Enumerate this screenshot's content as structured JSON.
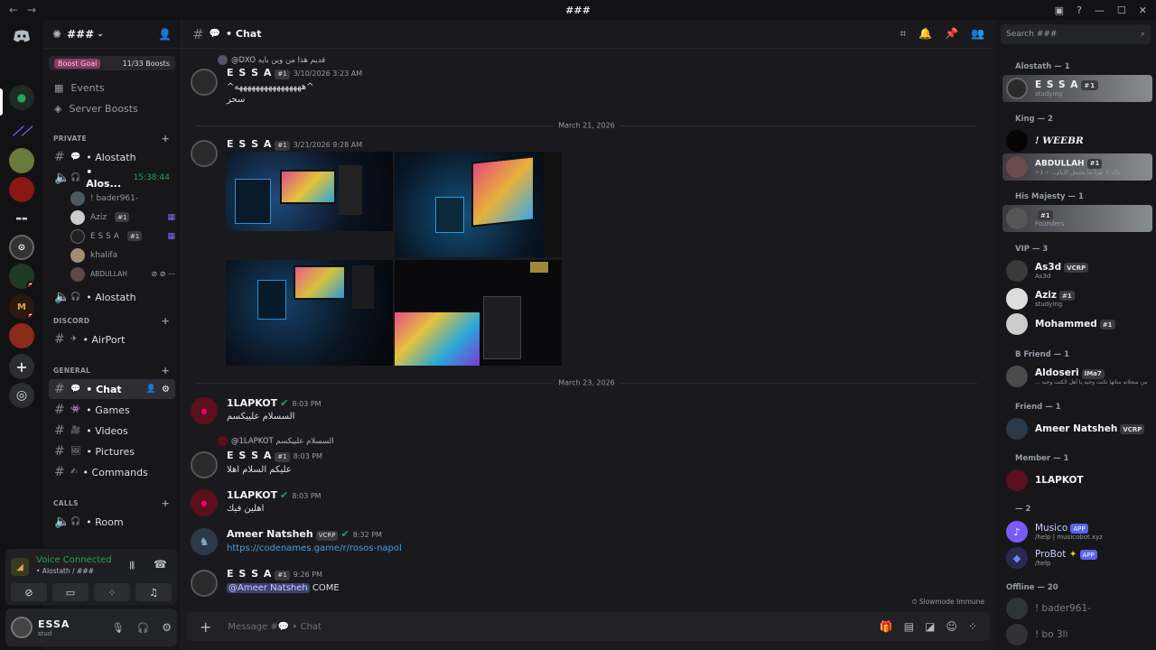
{
  "window": {
    "title": "###",
    "back": "←",
    "forward": "→",
    "min": "—",
    "max": "☐",
    "close": "✕"
  },
  "guilds": {
    "badge1": "1",
    "badge2": "2"
  },
  "server": {
    "name": "###",
    "boost_goal": "Boost Goal",
    "boost_count": "11/33 Boosts",
    "events": "Events",
    "server_boosts": "Server Boosts"
  },
  "categories": {
    "private": "PRIVATE",
    "discord": "DISCORD",
    "general": "GENERAL",
    "calls": "CALLS"
  },
  "channels": {
    "alostath": "• Alostath",
    "alos_voice": "• Alos...",
    "alos_timer": "15:38:44",
    "voice_users": [
      "! bader961-",
      "Aziz",
      "E S S A",
      "khalifa",
      "ABDULLAH"
    ],
    "alostath_voice": "• Alostath",
    "airport": "• AirPort",
    "chat": "• Chat",
    "games": "• Games",
    "videos": "• Videos",
    "pictures": "• Pictures",
    "commands": "• Commands",
    "room": "• Room"
  },
  "voice": {
    "status": "Voice Connected",
    "location": "• Alostath / ###"
  },
  "me": {
    "name": "ESSA",
    "status": "stud"
  },
  "chat": {
    "channel": "• Chat",
    "reply1": "@DXO قديم هذا من وين بايه",
    "m1_user": "E S S A",
    "m1_time": "3/10/2026 3:23 AM",
    "m1_text1": "^ههههههههههههههههه^",
    "m1_text2": "سحر",
    "date1": "March 21, 2026",
    "m2_user": "E S S A",
    "m2_time": "3/21/2026 9:28 AM",
    "date2": "March 23, 2026",
    "m3_user": "1LAPKOT",
    "m3_time": "8:03 PM",
    "m3_text": "السسلام علييكسم",
    "reply2": "@1LAPKOT السسلام علييكسم",
    "m4_user": "E S S A",
    "m4_time": "8:03 PM",
    "m4_text": "عليكم السلام اهلا",
    "m5_user": "1LAPKOT",
    "m5_time": "8:03 PM",
    "m5_text": "اهلين فيك",
    "m6_user": "Ameer Natsheh",
    "m6_tag": "VCRP",
    "m6_time": "8:32 PM",
    "m6_link": "https://codenames.game/r/rosos-napol",
    "m7_user": "E S S A",
    "m7_time": "9:26 PM",
    "m7_mention": "@Ameer Natsheh",
    "m7_text": " COME",
    "slowmode": "Slowmode Immune",
    "placeholder": "Message #💬 • Chat",
    "tag_essa": "#1"
  },
  "members": {
    "search": "Search ###",
    "cat_alostath": "Alostath — 1",
    "essa_name": "E S S A",
    "essa_status": "studying",
    "cat_king": "King — 2",
    "weebr": "! WEEBR",
    "abdullah": "ABDULLAH",
    "abdullah_status": "+1 • ...حالة لا تقرأ ما تحتمل الأيام",
    "cat_majesty": "His Majesty — 1",
    "founders": "Founders",
    "cat_vip": "VIP — 3",
    "as3d": "As3d",
    "as3d_tag": "VCRP",
    "as3d_status": "As3d",
    "aziz": "Aziz",
    "aziz_status": "studying",
    "mohammed": "Mohammed",
    "cat_bfriend": "B Friend — 1",
    "aldoseri": "Aldoseri",
    "aldoseri_tag": "IMa7",
    "aldoseri_status": "... من سجلاته مناتها تكنت وجيه يا أهل الكتت وجيه",
    "cat_friend": "Friend — 1",
    "ameer": "Ameer Natsheh",
    "ameer_tag": "VCRP",
    "cat_member": "Member — 1",
    "lapkot": "1LAPKOT",
    "cat_2": "— 2",
    "musico": "Musico",
    "app": "APP",
    "musico_status": "/help | musicobot.xyz",
    "probot": "ProBot",
    "probot_status": "/help",
    "cat_offline": "Offline — 20",
    "off1": "! bader961-",
    "off2": "! bo 3li"
  },
  "colors": {
    "accent": "#5865f2",
    "green": "#23a55a",
    "link": "#00a8fc"
  }
}
